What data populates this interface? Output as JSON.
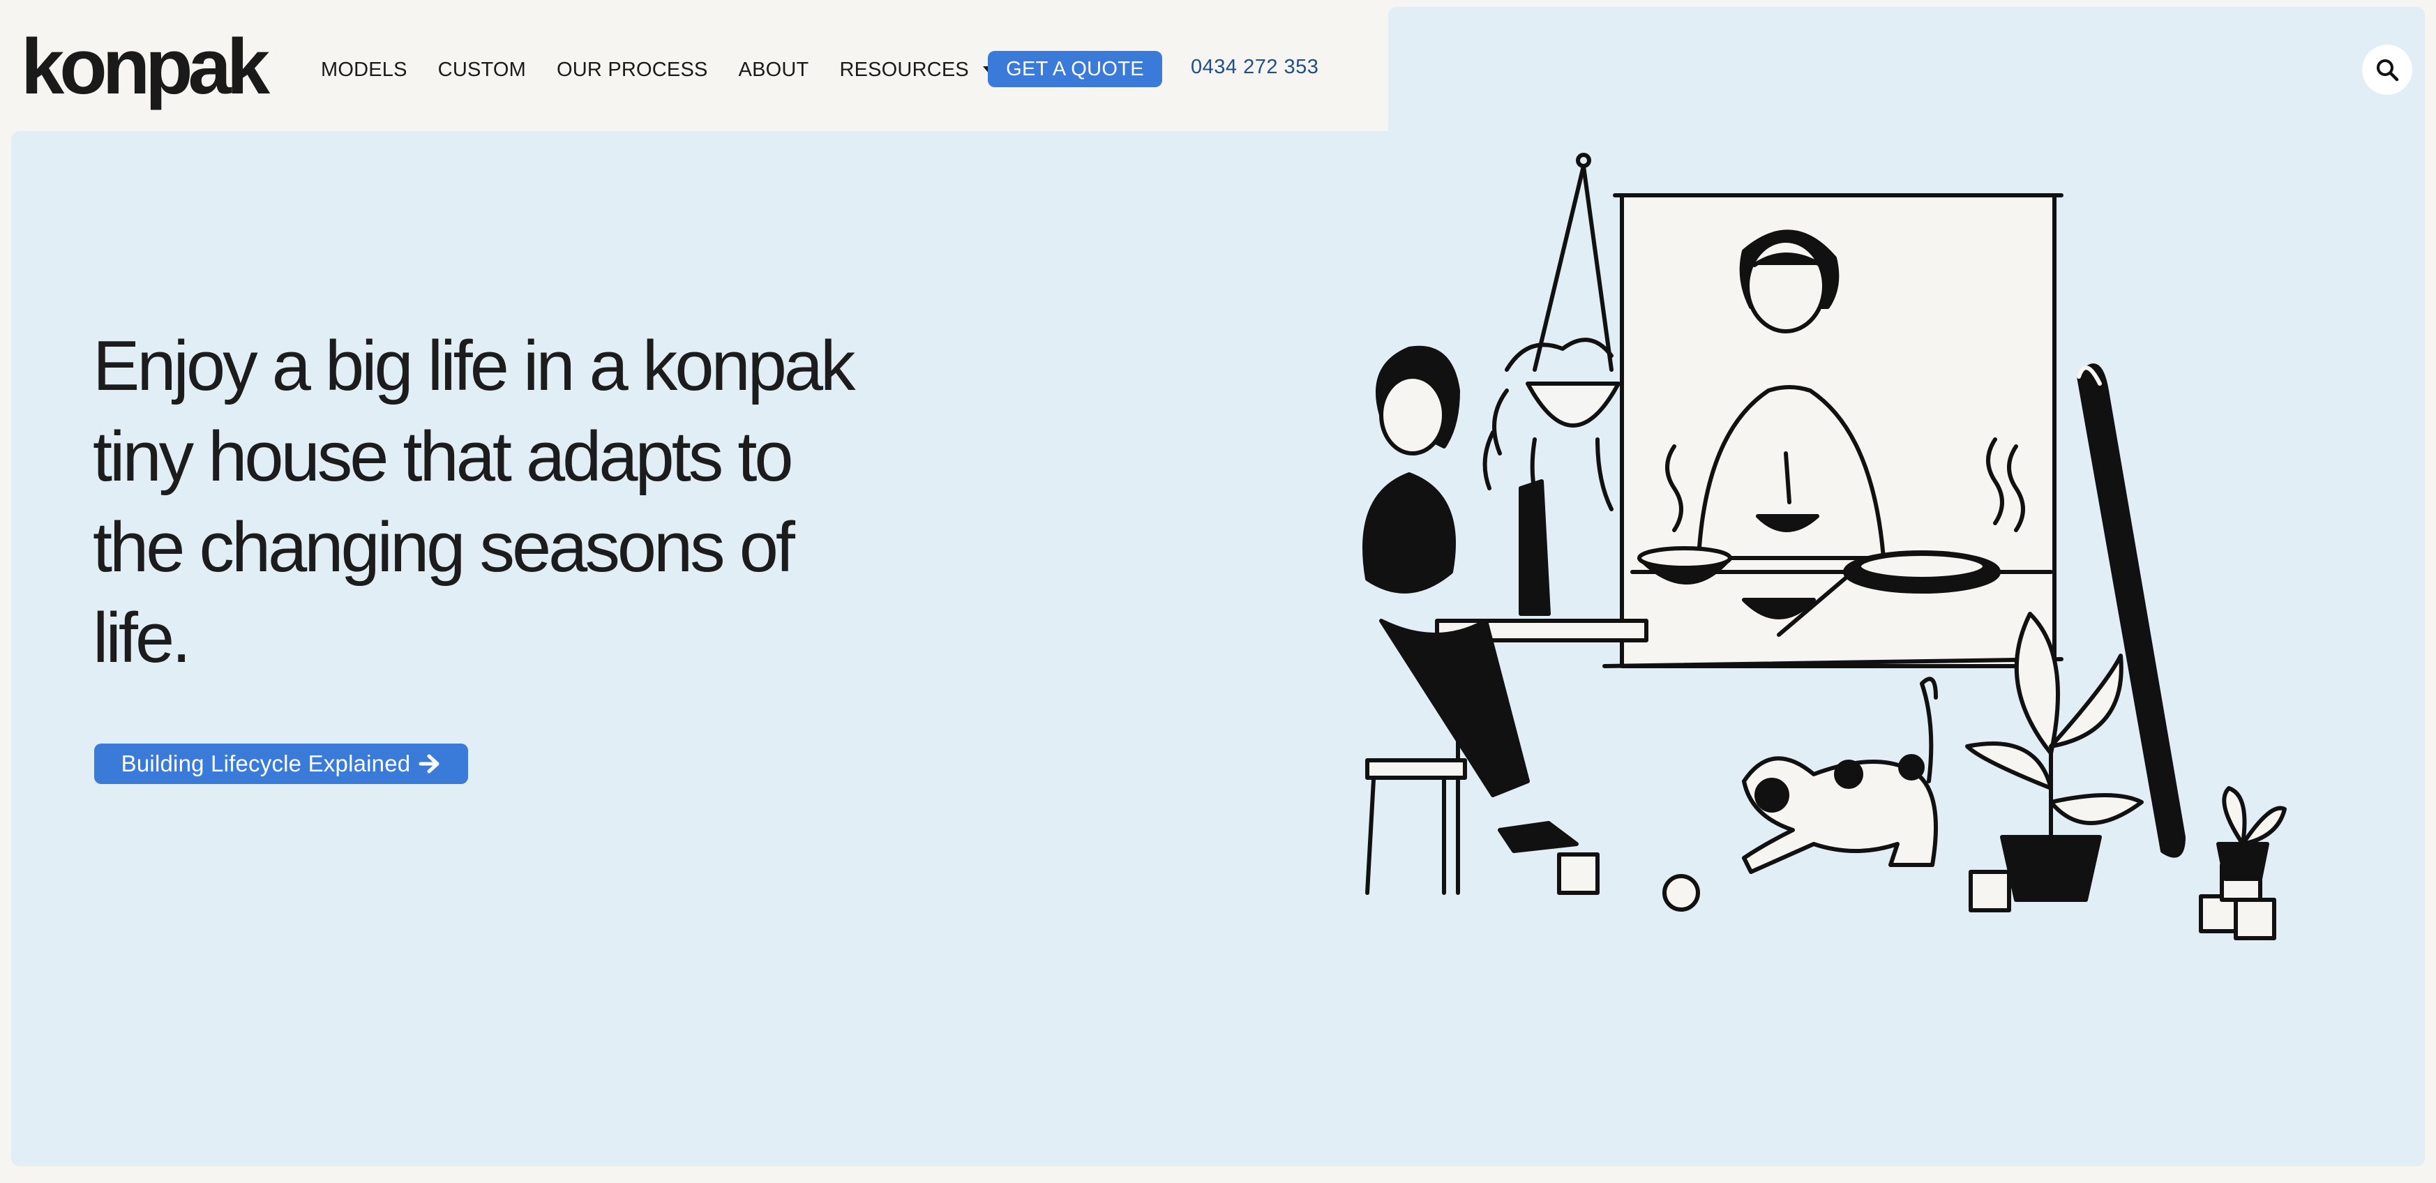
{
  "brand": {
    "logo_text": "konpak",
    "accent_color": "#3a7bd9",
    "hero_background": "#e1eef6",
    "page_background": "#f6f5f1"
  },
  "nav": {
    "items": [
      {
        "label": "MODELS"
      },
      {
        "label": "CUSTOM"
      },
      {
        "label": "OUR PROCESS"
      },
      {
        "label": "ABOUT"
      },
      {
        "label": "RESOURCES",
        "has_dropdown": true
      }
    ],
    "quote_button": "GET A QUOTE",
    "phone": "0434 272 353",
    "search_icon": "search-icon"
  },
  "hero": {
    "headline_lines": [
      "Enjoy a big life in a konpak",
      "tiny house that adapts to",
      "the changing seasons of",
      "life."
    ],
    "cta_label": "Building Lifecycle Explained",
    "cta_icon": "arrow-right-icon",
    "illustration_icon": "tiny-house-lifestyle-illustration"
  }
}
